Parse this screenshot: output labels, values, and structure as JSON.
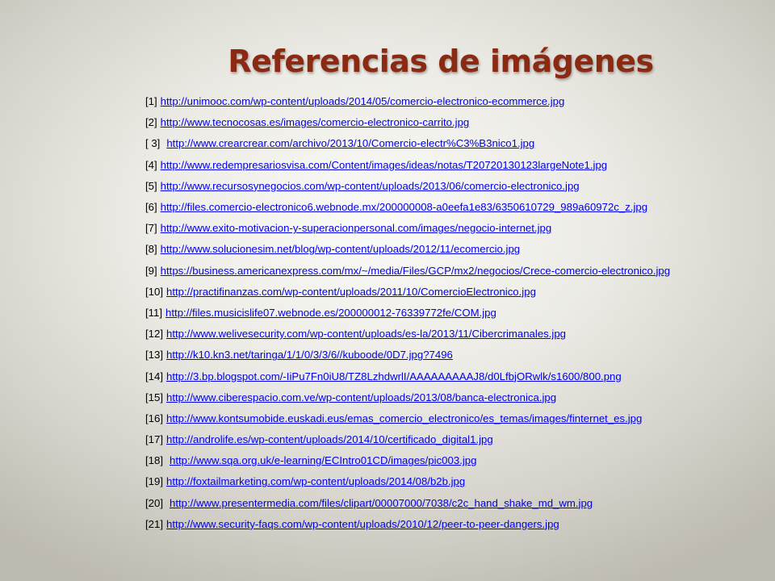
{
  "slide": {
    "title": "Referencias de imágenes",
    "accent_color": "#8b2a12",
    "link_color": "#0000ee",
    "references": [
      {
        "num": "[1]",
        "url": "http://unimooc.com/wp-content/uploads/2014/05/comercio-electronico-ecommerce.jpg"
      },
      {
        "num": "[2]",
        "url": "http://www.tecnocosas.es/images/comercio-electronico-carrito.jpg"
      },
      {
        "num": "[ 3]",
        "url": "http://www.crearcrear.com/archivo/2013/10/Comercio-electr%C3%B3nico1.jpg"
      },
      {
        "num": "[4]",
        "url": "http://www.redempresariosvisa.com/Content/images/ideas/notas/T20720130123largeNote1.jpg"
      },
      {
        "num": "[5]",
        "url": "http://www.recursosynegocios.com/wp-content/uploads/2013/06/comercio-electronico.jpg"
      },
      {
        "num": "[6]",
        "url": "http://files.comercio-electronico6.webnode.mx/200000008-a0eefa1e83/6350610729_989a60972c_z.jpg"
      },
      {
        "num": "[7]",
        "url": "http://www.exito-motivacion-y-superacionpersonal.com/images/negocio-internet.jpg"
      },
      {
        "num": "[8]",
        "url": "http://www.solucionesim.net/blog/wp-content/uploads/2012/11/ecomercio.jpg"
      },
      {
        "num": "[9]",
        "url": "https://business.americanexpress.com/mx/~/media/Files/GCP/mx2/negocios/Crece-comercio-electronico.jpg"
      },
      {
        "num": "[10]",
        "url": "http://practifinanzas.com/wp-content/uploads/2011/10/ComercioElectronico.jpg"
      },
      {
        "num": "[11]",
        "url": "http://files.musicislife07.webnode.es/200000012-76339772fe/COM.jpg"
      },
      {
        "num": "[12]",
        "url": "http://www.welivesecurity.com/wp-content/uploads/es-la/2013/11/Cibercrimanales.jpg"
      },
      {
        "num": "[13]",
        "url": "http://k10.kn3.net/taringa/1/1/0/3/3/6//kuboode/0D7.jpg?7496"
      },
      {
        "num": "[14]",
        "url": "http://3.bp.blogspot.com/-IiPu7Fn0iU8/TZ8LzhdwrlI/AAAAAAAAAJ8/d0LfbjORwlk/s1600/800.png"
      },
      {
        "num": "[15]",
        "url": "http://www.ciberespacio.com.ve/wp-content/uploads/2013/08/banca-electronica.jpg"
      },
      {
        "num": "[16]",
        "url": "http://www.kontsumobide.euskadi.eus/emas_comercio_electronico/es_temas/images/finternet_es.jpg"
      },
      {
        "num": "[17]",
        "url": "http://androlife.es/wp-content/uploads/2014/10/certificado_digital1.jpg"
      },
      {
        "num": "[18]",
        "url": "http://www.sqa.org.uk/e-learning/ECIntro01CD/images/pic003.jpg"
      },
      {
        "num": "[19]",
        "url": "http://foxtailmarketing.com/wp-content/uploads/2014/08/b2b.jpg"
      },
      {
        "num": "[20]",
        "url": "http://www.presentermedia.com/files/clipart/00007000/7038/c2c_hand_shake_md_wm.jpg"
      },
      {
        "num": "[21]",
        "url": "http://www.security-faqs.com/wp-content/uploads/2010/12/peer-to-peer-dangers.jpg"
      }
    ]
  }
}
